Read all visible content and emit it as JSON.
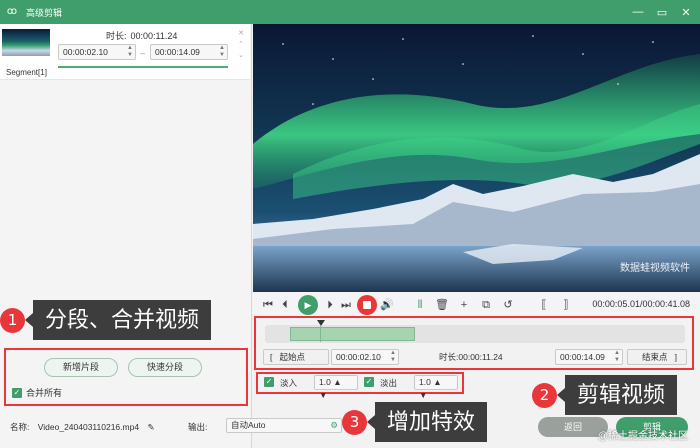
{
  "window": {
    "title": "高级剪辑",
    "buttons": [
      "—",
      "▭",
      "✕"
    ]
  },
  "segment": {
    "name": "Segment[1]",
    "duration_label": "时长:",
    "duration": "00:00:11.24",
    "start": "00:00:02.10",
    "end": "00:00:14.09"
  },
  "callouts": [
    {
      "num": "1",
      "text": "分段、合并视频"
    },
    {
      "num": "2",
      "text": "剪辑视频"
    },
    {
      "num": "3",
      "text": "增加特效"
    }
  ],
  "left_actions": {
    "add_segment": "新增片段",
    "quick_split": "快速分段",
    "merge_all": "合并所有"
  },
  "video": {
    "caption": "数据蛙视频软件"
  },
  "player": {
    "timecode": "00:00:05.01/00:00:41.08"
  },
  "range": {
    "start_point": "起始点",
    "start_value": "00:00:02.10",
    "duration_label": "时长:",
    "duration_value": "00:00:11.24",
    "end_value": "00:00:14.09",
    "end_point": "结束点"
  },
  "effects": {
    "fade_in_label": "淡入",
    "fade_in_value": "1.0",
    "fade_out_label": "淡出",
    "fade_out_value": "1.0"
  },
  "footer": {
    "name_label": "名称:",
    "filename": "Video_240403110216.mp4",
    "output_label": "输出:",
    "output_value": "自动Auto",
    "back": "返回",
    "clip": "剪辑"
  },
  "watermark": "@稀土掘金技术社区",
  "colors": {
    "accent": "#3f9e6c",
    "callout_red": "#e8373a",
    "callout_bg": "#3d3d3d"
  }
}
